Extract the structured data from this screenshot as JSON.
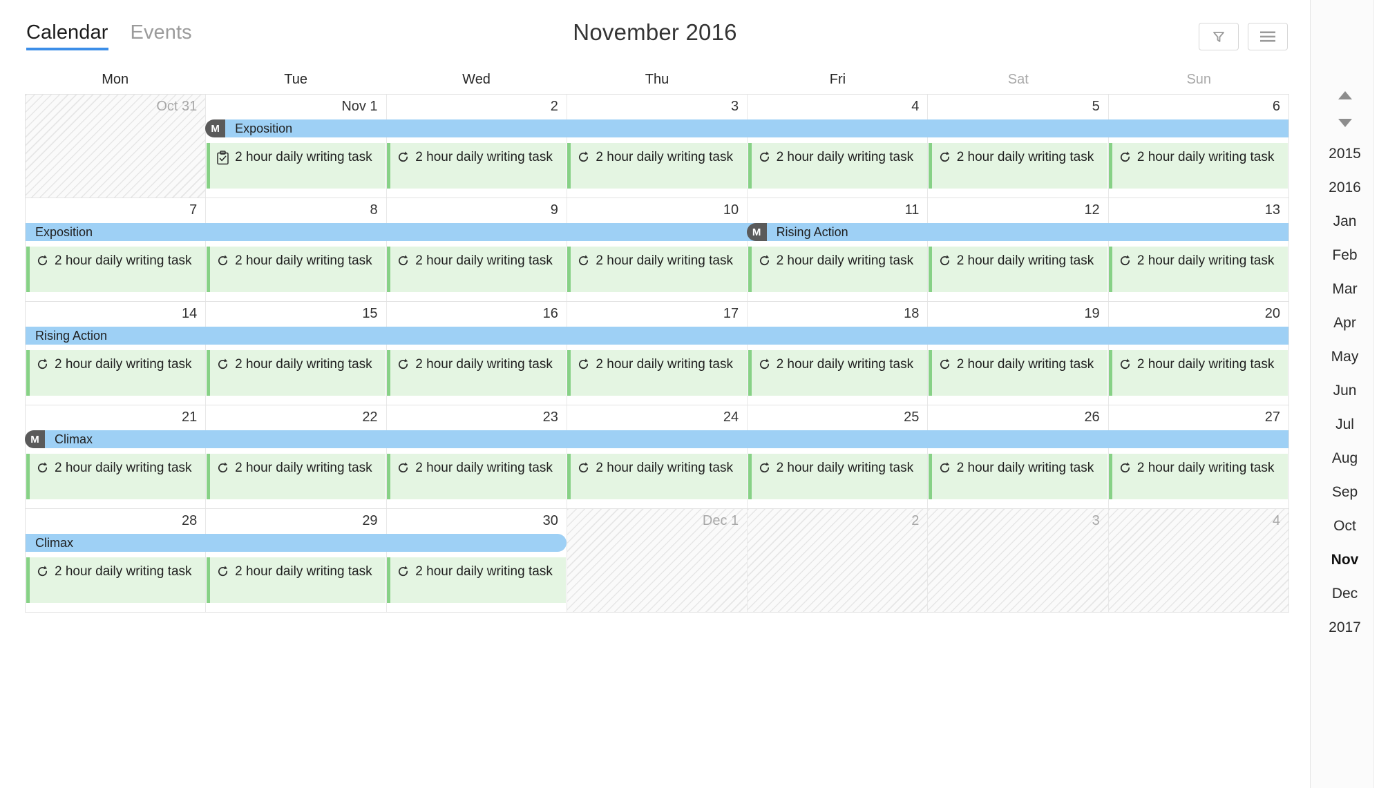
{
  "header": {
    "tabs": [
      {
        "label": "Calendar",
        "active": true
      },
      {
        "label": "Events",
        "active": false
      }
    ],
    "title": "November 2016",
    "actions": [
      {
        "name": "filter-button",
        "icon": "funnel-icon"
      },
      {
        "name": "menu-button",
        "icon": "hamburger-icon"
      }
    ]
  },
  "calendar": {
    "weekdays": [
      {
        "label": "Mon",
        "muted": false
      },
      {
        "label": "Tue",
        "muted": false
      },
      {
        "label": "Wed",
        "muted": false
      },
      {
        "label": "Thu",
        "muted": false
      },
      {
        "label": "Fri",
        "muted": false
      },
      {
        "label": "Sat",
        "muted": true
      },
      {
        "label": "Sun",
        "muted": true
      }
    ],
    "task_label": "2 hour daily writing task",
    "weeks": [
      {
        "days": [
          {
            "num": "Oct 31",
            "out": true,
            "hatched": true,
            "task": false
          },
          {
            "num": "Nov 1",
            "out": false,
            "hatched": false,
            "task": true,
            "icon": "clipboard-check-icon"
          },
          {
            "num": "2",
            "out": false,
            "hatched": false,
            "task": true,
            "icon": "repeat-icon"
          },
          {
            "num": "3",
            "out": false,
            "hatched": false,
            "task": true,
            "icon": "repeat-icon"
          },
          {
            "num": "4",
            "out": false,
            "hatched": false,
            "task": true,
            "icon": "repeat-icon"
          },
          {
            "num": "5",
            "out": false,
            "hatched": false,
            "task": true,
            "icon": "repeat-icon"
          },
          {
            "num": "6",
            "out": false,
            "hatched": false,
            "task": true,
            "icon": "repeat-icon"
          }
        ],
        "bars": [
          {
            "label": "Exposition",
            "badge": "M",
            "start": 1,
            "end": 7,
            "round_left": true,
            "round_right": false
          }
        ]
      },
      {
        "days": [
          {
            "num": "7",
            "out": false,
            "hatched": false,
            "task": true,
            "icon": "repeat-icon"
          },
          {
            "num": "8",
            "out": false,
            "hatched": false,
            "task": true,
            "icon": "repeat-icon"
          },
          {
            "num": "9",
            "out": false,
            "hatched": false,
            "task": true,
            "icon": "repeat-icon"
          },
          {
            "num": "10",
            "out": false,
            "hatched": false,
            "task": true,
            "icon": "repeat-icon"
          },
          {
            "num": "11",
            "out": false,
            "hatched": false,
            "task": true,
            "icon": "repeat-icon"
          },
          {
            "num": "12",
            "out": false,
            "hatched": false,
            "task": true,
            "icon": "repeat-icon"
          },
          {
            "num": "13",
            "out": false,
            "hatched": false,
            "task": true,
            "icon": "repeat-icon"
          }
        ],
        "bars": [
          {
            "label": "Exposition",
            "badge": "",
            "start": 0,
            "end": 5,
            "round_left": false,
            "round_right": true
          },
          {
            "label": "Rising Action",
            "badge": "M",
            "start": 4,
            "end": 7,
            "round_left": true,
            "round_right": false
          }
        ]
      },
      {
        "days": [
          {
            "num": "14",
            "out": false,
            "hatched": false,
            "task": true,
            "icon": "repeat-icon"
          },
          {
            "num": "15",
            "out": false,
            "hatched": false,
            "task": true,
            "icon": "repeat-icon"
          },
          {
            "num": "16",
            "out": false,
            "hatched": false,
            "task": true,
            "icon": "repeat-icon"
          },
          {
            "num": "17",
            "out": false,
            "hatched": false,
            "task": true,
            "icon": "repeat-icon"
          },
          {
            "num": "18",
            "out": false,
            "hatched": false,
            "task": true,
            "icon": "repeat-icon"
          },
          {
            "num": "19",
            "out": false,
            "hatched": false,
            "task": true,
            "icon": "repeat-icon"
          },
          {
            "num": "20",
            "out": false,
            "hatched": false,
            "task": true,
            "icon": "repeat-icon"
          }
        ],
        "bars": [
          {
            "label": "Rising Action",
            "badge": "",
            "start": 0,
            "end": 7,
            "round_left": false,
            "round_right": false
          }
        ]
      },
      {
        "days": [
          {
            "num": "21",
            "out": false,
            "hatched": false,
            "task": true,
            "icon": "repeat-icon"
          },
          {
            "num": "22",
            "out": false,
            "hatched": false,
            "task": true,
            "icon": "repeat-icon"
          },
          {
            "num": "23",
            "out": false,
            "hatched": false,
            "task": true,
            "icon": "repeat-icon"
          },
          {
            "num": "24",
            "out": false,
            "hatched": false,
            "task": true,
            "icon": "repeat-icon"
          },
          {
            "num": "25",
            "out": false,
            "hatched": false,
            "task": true,
            "icon": "repeat-icon"
          },
          {
            "num": "26",
            "out": false,
            "hatched": false,
            "task": true,
            "icon": "repeat-icon"
          },
          {
            "num": "27",
            "out": false,
            "hatched": false,
            "task": true,
            "icon": "repeat-icon"
          }
        ],
        "bars": [
          {
            "label": "Climax",
            "badge": "M",
            "start": 0,
            "end": 7,
            "round_left": true,
            "round_right": false
          }
        ]
      },
      {
        "days": [
          {
            "num": "28",
            "out": false,
            "hatched": false,
            "task": true,
            "icon": "repeat-icon"
          },
          {
            "num": "29",
            "out": false,
            "hatched": false,
            "task": true,
            "icon": "repeat-icon"
          },
          {
            "num": "30",
            "out": false,
            "hatched": false,
            "task": true,
            "icon": "repeat-icon"
          },
          {
            "num": "Dec 1",
            "out": true,
            "hatched": true,
            "task": false
          },
          {
            "num": "2",
            "out": true,
            "hatched": true,
            "task": false
          },
          {
            "num": "3",
            "out": true,
            "hatched": true,
            "task": false
          },
          {
            "num": "4",
            "out": true,
            "hatched": true,
            "task": false
          }
        ],
        "bars": [
          {
            "label": "Climax",
            "badge": "",
            "start": 0,
            "end": 3,
            "round_left": false,
            "round_right": true
          }
        ]
      }
    ]
  },
  "sidebar": {
    "scroll_up": "scroll-up-arrow",
    "scroll_down": "scroll-down-arrow",
    "items": [
      {
        "label": "2015",
        "type": "year",
        "current": false
      },
      {
        "label": "2016",
        "type": "year",
        "current": false
      },
      {
        "label": "Jan",
        "type": "month",
        "current": false
      },
      {
        "label": "Feb",
        "type": "month",
        "current": false
      },
      {
        "label": "Mar",
        "type": "month",
        "current": false
      },
      {
        "label": "Apr",
        "type": "month",
        "current": false
      },
      {
        "label": "May",
        "type": "month",
        "current": false
      },
      {
        "label": "Jun",
        "type": "month",
        "current": false
      },
      {
        "label": "Jul",
        "type": "month",
        "current": false
      },
      {
        "label": "Aug",
        "type": "month",
        "current": false
      },
      {
        "label": "Sep",
        "type": "month",
        "current": false
      },
      {
        "label": "Oct",
        "type": "month",
        "current": false
      },
      {
        "label": "Nov",
        "type": "month",
        "current": true
      },
      {
        "label": "Dec",
        "type": "month",
        "current": false
      },
      {
        "label": "2017",
        "type": "year",
        "current": false
      }
    ]
  },
  "colors": {
    "accent": "#3c8ee8",
    "event_bar": "#9ed0f5",
    "task_bg": "#e4f5e2",
    "task_accent": "#87d186",
    "badge": "#5a5a5a"
  }
}
